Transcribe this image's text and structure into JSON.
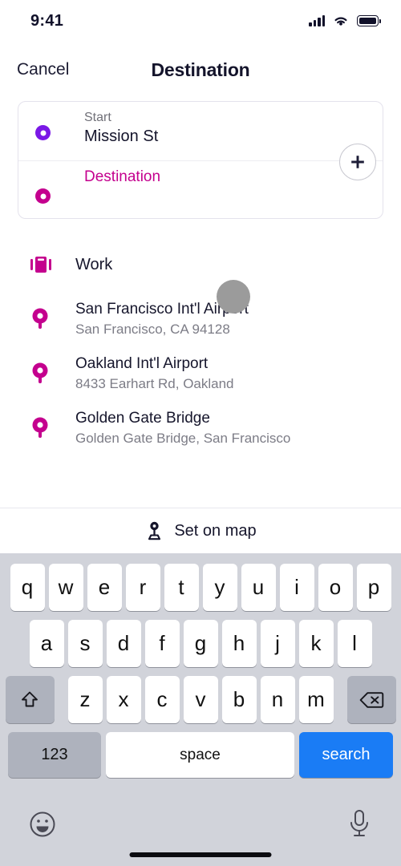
{
  "status_bar": {
    "time": "9:41",
    "signal_icon": "cellular-signal-icon",
    "wifi_icon": "wifi-icon",
    "battery_icon": "battery-icon"
  },
  "header": {
    "cancel_label": "Cancel",
    "title": "Destination"
  },
  "route_card": {
    "start": {
      "label": "Start",
      "value": "Mission St",
      "dot_color": "#7a18e6"
    },
    "destination": {
      "placeholder": "Destination",
      "dot_color": "#c4008e"
    },
    "add_stop_icon": "plus-icon"
  },
  "suggestions": [
    {
      "icon": "briefcase-icon",
      "title": "Work",
      "subtitle": ""
    },
    {
      "icon": "map-pin-icon",
      "title": "San Francisco Int'l Airport",
      "subtitle": "San Francisco, CA 94128"
    },
    {
      "icon": "map-pin-icon",
      "title": "Oakland Int'l Airport",
      "subtitle": "8433 Earhart Rd, Oakland"
    },
    {
      "icon": "map-pin-icon",
      "title": "Golden Gate Bridge",
      "subtitle": "Golden Gate Bridge, San Francisco"
    }
  ],
  "set_on_map": {
    "icon": "map-pin-stand-icon",
    "label": "Set on map"
  },
  "keyboard": {
    "row1": [
      "q",
      "w",
      "e",
      "r",
      "t",
      "y",
      "u",
      "i",
      "o",
      "p"
    ],
    "row2": [
      "a",
      "s",
      "d",
      "f",
      "g",
      "h",
      "j",
      "k",
      "l"
    ],
    "row3": [
      "z",
      "x",
      "c",
      "v",
      "b",
      "n",
      "m"
    ],
    "shift_icon": "shift-arrow-icon",
    "backspace_icon": "backspace-icon",
    "numbers_label": "123",
    "space_label": "space",
    "search_label": "search",
    "emoji_icon": "emoji-smiley-icon",
    "mic_icon": "microphone-icon"
  },
  "colors": {
    "accent_magenta": "#c4008e",
    "accent_purple": "#7a18e6",
    "search_blue": "#1a7cf5",
    "text_dark": "#14142b",
    "text_muted": "#7c7c86",
    "keyboard_bg": "#d1d3da"
  },
  "cursor": {
    "name": "touch-indicator"
  }
}
